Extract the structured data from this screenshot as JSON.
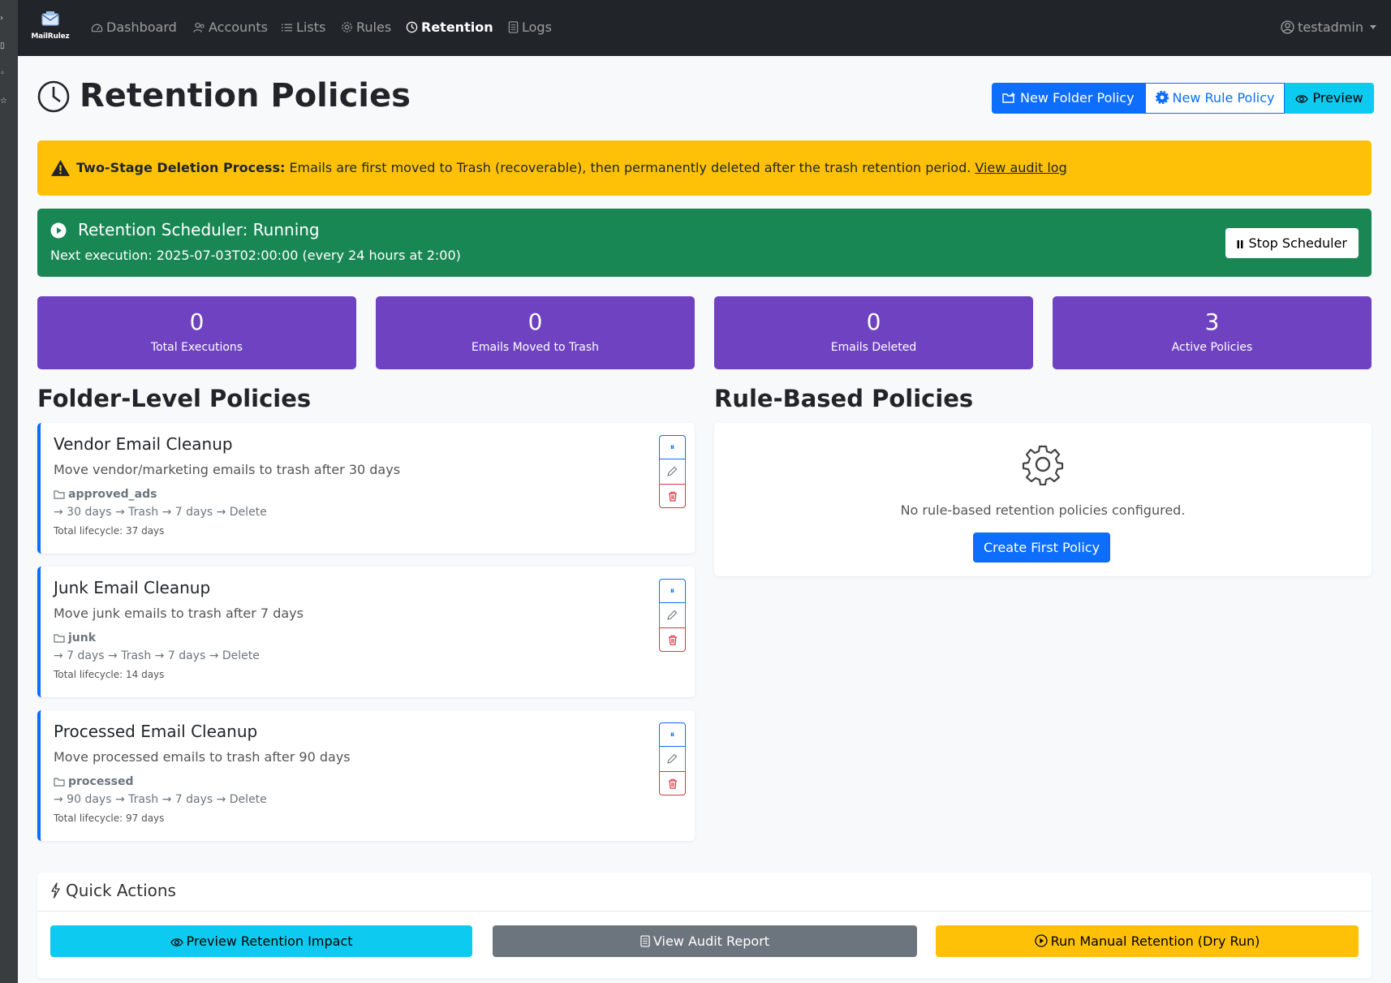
{
  "navbar": {
    "brand": "MailRulez",
    "items": [
      {
        "label": "Dashboard",
        "icon": "speedometer-icon"
      },
      {
        "label": "Accounts",
        "icon": "people-icon"
      },
      {
        "label": "Lists",
        "icon": "list-icon"
      },
      {
        "label": "Rules",
        "icon": "gear-icon"
      },
      {
        "label": "Retention",
        "icon": "clock-icon",
        "active": true
      },
      {
        "label": "Logs",
        "icon": "document-icon"
      }
    ],
    "user": "testadmin"
  },
  "page": {
    "title": "Retention Policies",
    "buttons": {
      "new_folder_policy": "New Folder Policy",
      "new_rule_policy": "New Rule Policy",
      "preview": "Preview"
    }
  },
  "alert": {
    "title": "Two-Stage Deletion Process:",
    "text": " Emails are first moved to Trash (recoverable), then permanently deleted after the trash retention period. ",
    "link": "View audit log"
  },
  "scheduler": {
    "status": "Retention Scheduler: Running",
    "next_execution": "Next execution: 2025-07-03T02:00:00 (every 24 hours at 2:00)",
    "stop_label": "Stop Scheduler"
  },
  "stats": [
    {
      "value": "0",
      "label": "Total Executions"
    },
    {
      "value": "0",
      "label": "Emails Moved to Trash"
    },
    {
      "value": "0",
      "label": "Emails Deleted"
    },
    {
      "value": "3",
      "label": "Active Policies"
    }
  ],
  "folder_policies": {
    "title": "Folder-Level Policies",
    "items": [
      {
        "name": "Vendor Email Cleanup",
        "description": "Move vendor/marketing emails to trash after 30 days",
        "folder": "approved_ads",
        "flow": "→ 30 days → Trash → 7 days → Delete",
        "lifecycle": "Total lifecycle: 37 days"
      },
      {
        "name": "Junk Email Cleanup",
        "description": "Move junk emails to trash after 7 days",
        "folder": "junk",
        "flow": "→ 7 days → Trash → 7 days → Delete",
        "lifecycle": "Total lifecycle: 14 days"
      },
      {
        "name": "Processed Email Cleanup",
        "description": "Move processed emails to trash after 90 days",
        "folder": "processed",
        "flow": "→ 90 days → Trash → 7 days → Delete",
        "lifecycle": "Total lifecycle: 97 days"
      }
    ]
  },
  "rule_policies": {
    "title": "Rule-Based Policies",
    "empty_text": "No rule-based retention policies configured.",
    "create_label": "Create First Policy"
  },
  "quick_actions": {
    "title": "Quick Actions",
    "preview_label": "Preview Retention Impact",
    "audit_label": "View Audit Report",
    "run_label": "Run Manual Retention (Dry Run)"
  },
  "colors": {
    "navbar": "#212529",
    "primary": "#0d6efd",
    "info": "#0dcaf0",
    "warning": "#ffc107",
    "success": "#198754",
    "stat": "#6f42c1",
    "secondary": "#6c757d",
    "danger": "#dc3545"
  }
}
